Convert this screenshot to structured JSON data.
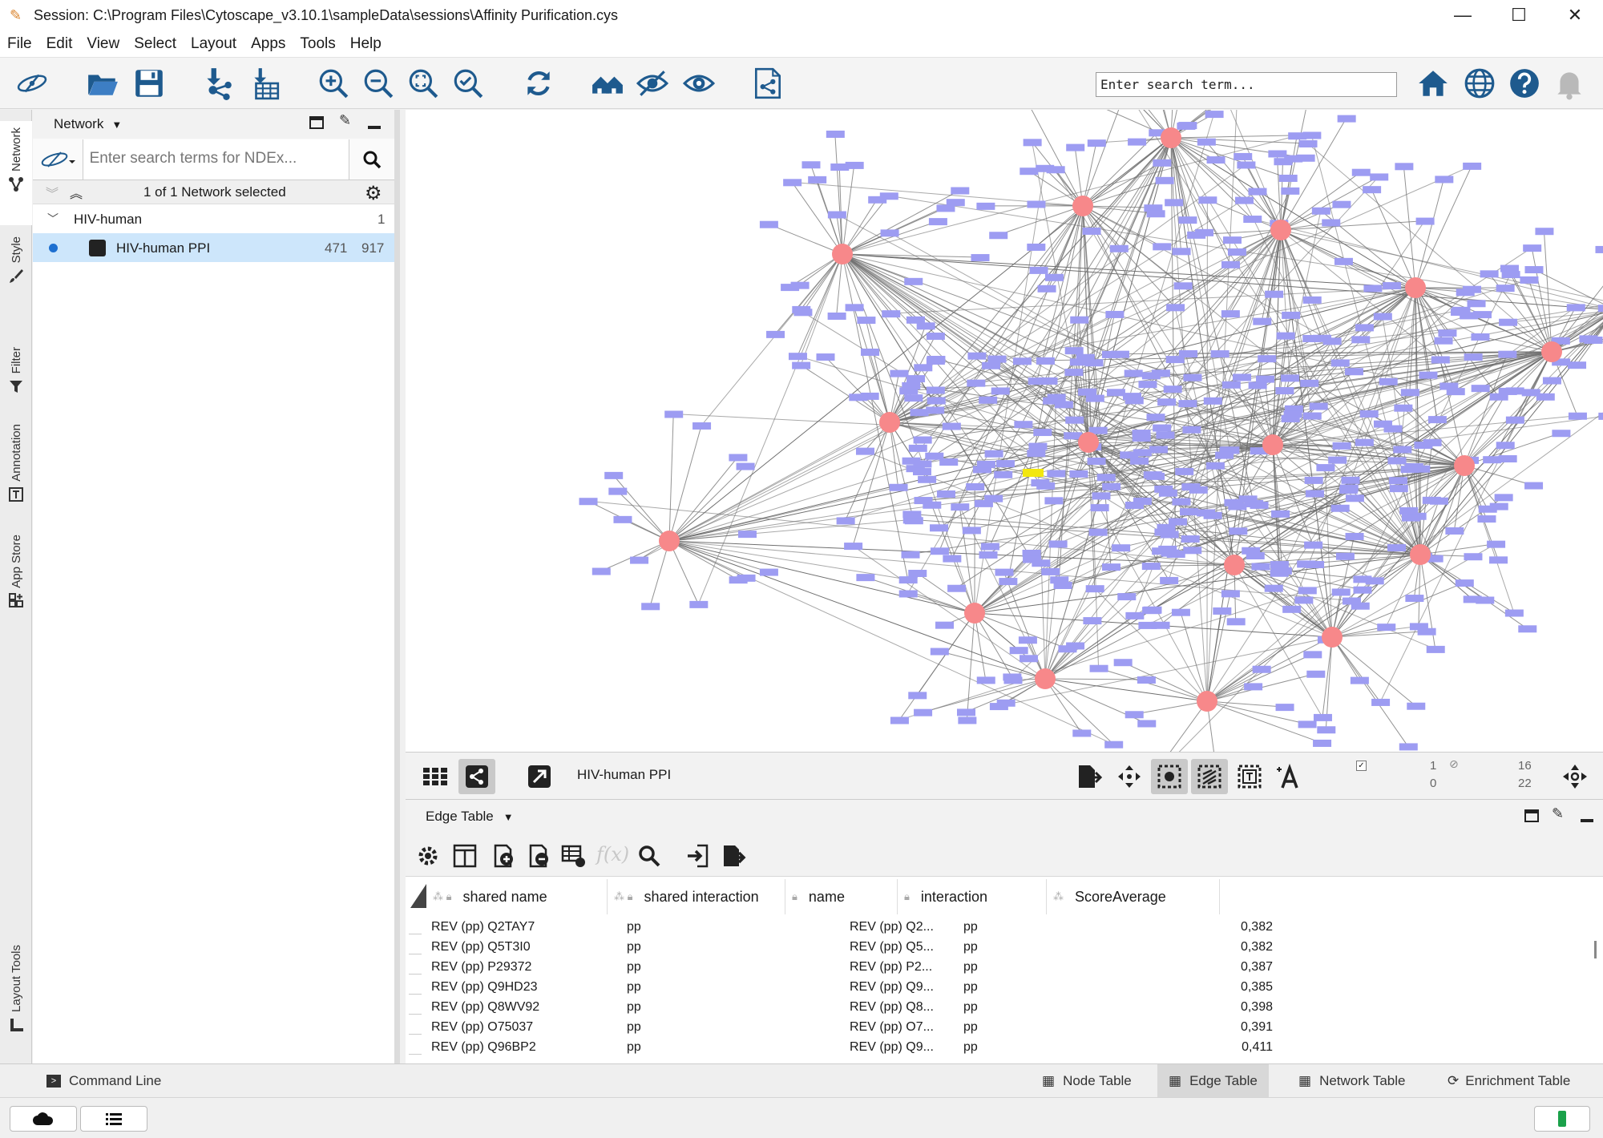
{
  "window": {
    "title": "Session: C:\\Program Files\\Cytoscape_v3.10.1\\sampleData\\sessions\\Affinity Purification.cys",
    "minimize": "—",
    "maximize": "☐",
    "close": "✕"
  },
  "menu": [
    "File",
    "Edit",
    "View",
    "Select",
    "Layout",
    "Apps",
    "Tools",
    "Help"
  ],
  "toolbar": {
    "search_placeholder": "Enter search term..."
  },
  "left_tabs": [
    "Network",
    "Style",
    "Filter",
    "Annotation",
    "App Store",
    "Layout Tools"
  ],
  "network_panel": {
    "title": "Network",
    "ndex_placeholder": "Enter search terms for NDEx...",
    "selection_text": "1 of 1 Network selected",
    "collection": {
      "name": "HIV-human",
      "count": "1"
    },
    "network": {
      "name": "HIV-human PPI",
      "nodes": "471",
      "edges": "917"
    }
  },
  "view_bar": {
    "network_name": "HIV-human PPI",
    "sel_nodes": "1",
    "sel_edges": "0",
    "hidden_nodes": "16",
    "hidden_edges": "22"
  },
  "table_panel": {
    "title": "Edge Table",
    "fx_label": "f(x)",
    "columns": [
      "shared name",
      "shared interaction",
      "name",
      "interaction",
      "ScoreAverage"
    ],
    "rows": [
      [
        "REV (pp) Q2TAY7",
        "pp",
        "REV (pp) Q2...",
        "pp",
        "0,382"
      ],
      [
        "REV (pp) Q5T3I0",
        "pp",
        "REV (pp) Q5...",
        "pp",
        "0,382"
      ],
      [
        "REV (pp) P29372",
        "pp",
        "REV (pp) P2...",
        "pp",
        "0,387"
      ],
      [
        "REV (pp) Q9HD23",
        "pp",
        "REV (pp) Q9...",
        "pp",
        "0,385"
      ],
      [
        "REV (pp) Q8WV92",
        "pp",
        "REV (pp) Q8...",
        "pp",
        "0,398"
      ],
      [
        "REV (pp) O75037",
        "pp",
        "REV (pp) O7...",
        "pp",
        "0,391"
      ],
      [
        "REV (pp) Q96BP2",
        "pp",
        "REV (pp) Q9...",
        "pp",
        "0,411"
      ]
    ]
  },
  "bottom_tabs": {
    "command_line": "Command Line",
    "node_table": "Node Table",
    "edge_table": "Edge Table",
    "network_table": "Network Table",
    "enrichment_table": "Enrichment Table"
  },
  "colors": {
    "hub_node": "#f7888a",
    "leaf_node": "#9d9cf2",
    "selected_node": "#f2e70f",
    "edge": "#6f6f6f",
    "selection_bg": "#cde6fb",
    "icon_blue": "#1e5a8e"
  }
}
